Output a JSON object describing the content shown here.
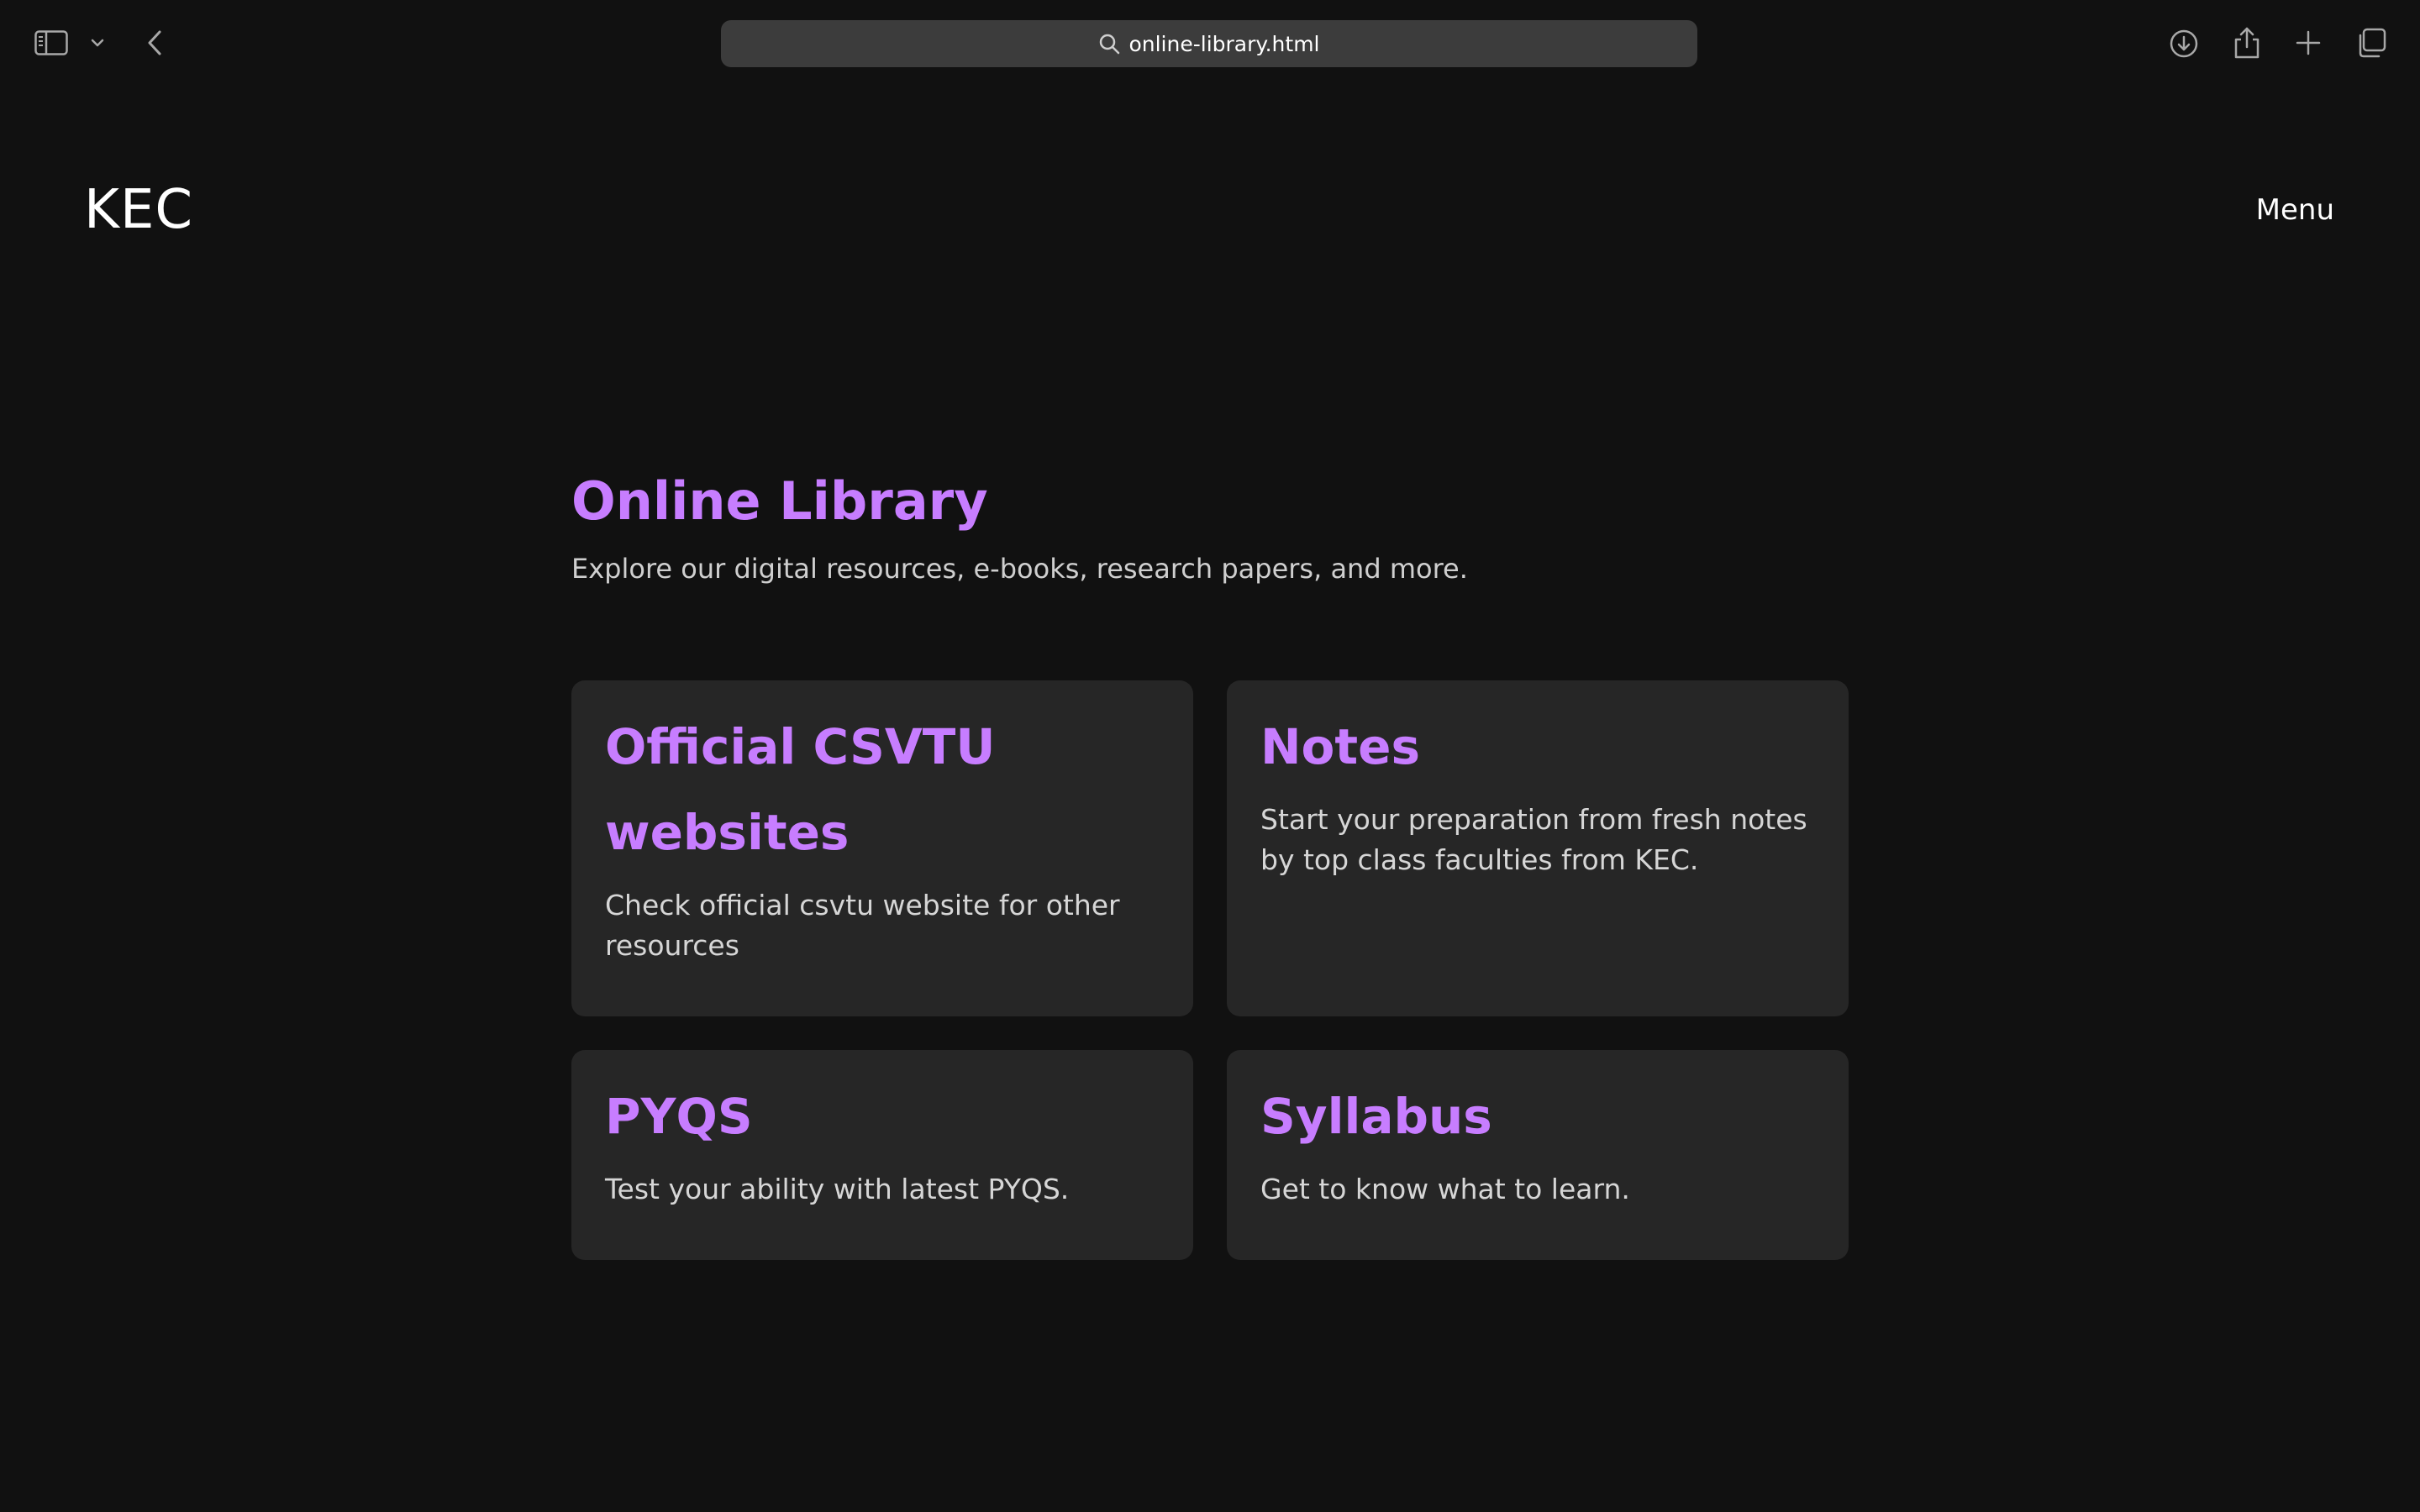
{
  "browser": {
    "url": "online-library.html",
    "icons": {
      "sidebar": "sidebar-icon",
      "tab_overview_menu": "chevron-down-icon",
      "back": "chevron-left-icon",
      "search": "search-icon",
      "downloads": "download-icon",
      "share": "share-icon",
      "new_tab": "plus-icon",
      "tabs": "tabs-icon"
    }
  },
  "header": {
    "logo": "KEC",
    "menu_label": "Menu"
  },
  "main": {
    "title": "Online Library",
    "subtitle": "Explore our digital resources, e-books, research papers, and more.",
    "cards": [
      {
        "title_line1": "Official CSVTU",
        "title_line2": "websites",
        "description": "Check official csvtu website for other resources"
      },
      {
        "title": "Notes",
        "description": "Start your preparation from fresh notes by top class faculties from KEC."
      },
      {
        "title": "PYQS",
        "description": "Test your ability with latest PYQS."
      },
      {
        "title": "Syllabus",
        "description": "Get to know what to learn."
      }
    ]
  },
  "colors": {
    "background": "#111111",
    "accent": "#c77dff",
    "card_background": "#262626",
    "text_muted": "#cfcfcf"
  }
}
